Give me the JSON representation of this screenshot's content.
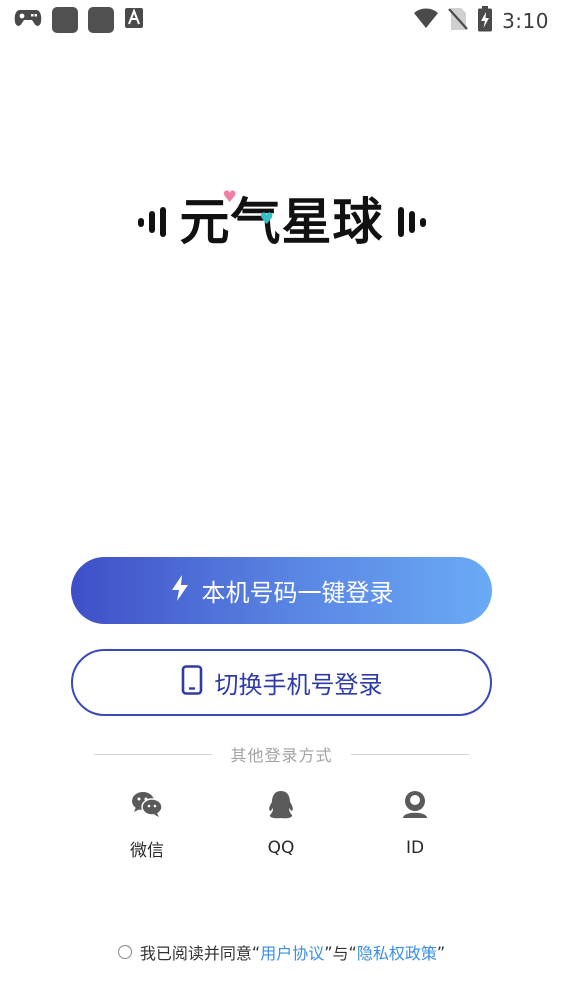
{
  "status_bar": {
    "time": "3:10",
    "left_icons": [
      "gamepad-icon",
      "app-square-icon",
      "app-square-icon",
      "text-a-icon"
    ],
    "right_icons": [
      "wifi-icon",
      "no-sim-icon",
      "battery-charging-icon"
    ]
  },
  "logo": {
    "text": "元气星球"
  },
  "buttons": {
    "one_click_login": "本机号码一键登录",
    "switch_phone_login": "切换手机号登录"
  },
  "other_login": {
    "divider_text": "其他登录方式",
    "options": [
      {
        "label": "微信",
        "icon": "wechat-icon"
      },
      {
        "label": "QQ",
        "icon": "qq-icon"
      },
      {
        "label": "ID",
        "icon": "user-id-icon"
      }
    ]
  },
  "agreement": {
    "prefix": "我已阅读并同意",
    "quote_open_1": "“",
    "user_agreement": "用户协议",
    "quote_close_1": "”",
    "joiner": "与",
    "quote_open_2": "“",
    "privacy_policy": "隐私权政策",
    "quote_close_2": "”"
  },
  "colors": {
    "primary_gradient_start": "#3e4fc7",
    "primary_gradient_end": "#6aaaf5",
    "secondary_border": "#3b49b8",
    "link": "#3a8ee6",
    "heart_pink": "#ef7fa3",
    "heart_cyan": "#33bfc8"
  }
}
